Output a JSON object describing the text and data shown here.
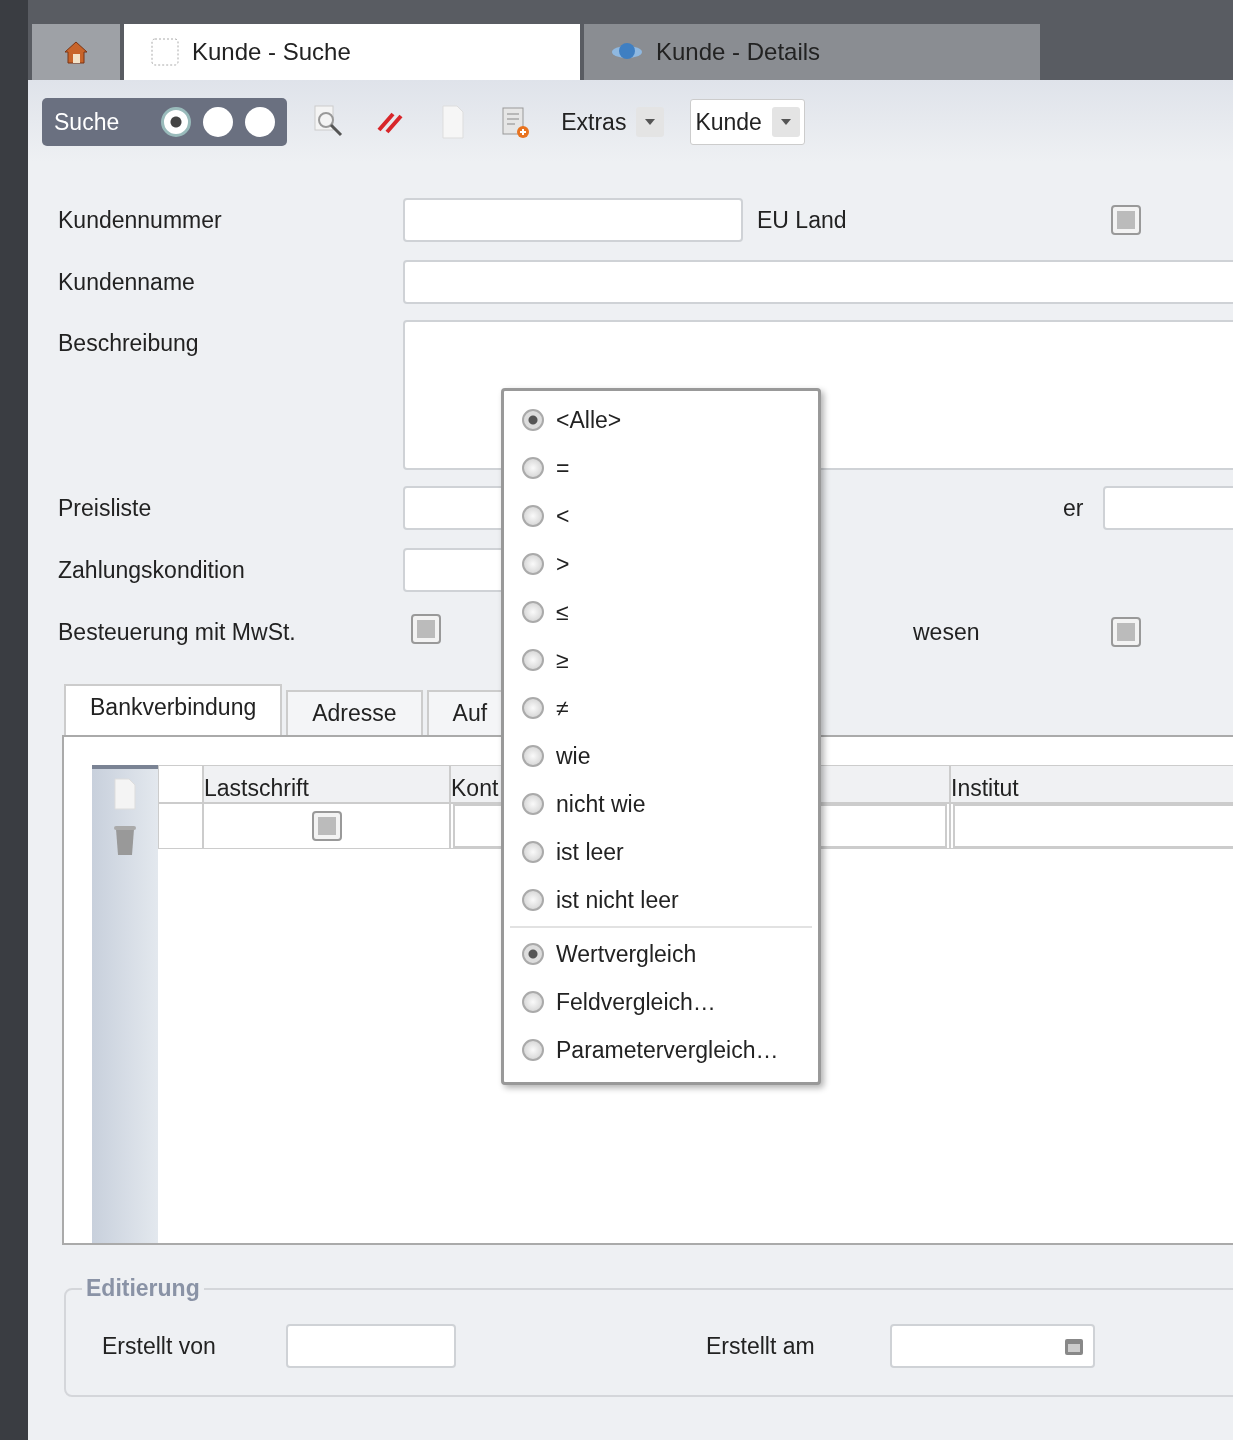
{
  "app_tabs": [
    {
      "kind": "search",
      "label": "Kunde - Suche",
      "selected": true
    },
    {
      "kind": "details",
      "label": "Kunde - Details",
      "selected": false
    }
  ],
  "toolbar": {
    "mode_label": "Suche",
    "mode_options": [
      {
        "selected": true
      },
      {
        "selected": false
      },
      {
        "selected": false
      }
    ],
    "extras": "Extras",
    "entity_select": "Kunde"
  },
  "rows": [
    {
      "kind": "text_with_check",
      "label": "Kundennummer",
      "check_label": "EU Land",
      "indeterminate": true
    },
    {
      "kind": "text",
      "label": "Kundenname"
    },
    {
      "kind": "area",
      "label": "Beschreibung"
    },
    {
      "kind": "text_pair",
      "label": "Preisliste",
      "second_label": "er"
    },
    {
      "kind": "short_text",
      "label": "Zahlungskondition"
    },
    {
      "kind": "check_pair",
      "label": "Besteuerung mit MwSt.",
      "indeterminate": true,
      "second_label": "wesen",
      "second_indeterminate": true
    }
  ],
  "detail_tabs": [
    {
      "label": "Bankverbindung",
      "selected": true
    },
    {
      "label": "Adresse",
      "selected": false
    },
    {
      "label": "Auf",
      "selected": false
    }
  ],
  "table": {
    "columns": [
      {
        "kind": "text",
        "label": "Lastschrift"
      },
      {
        "kind": "text",
        "label": "Kont"
      },
      {
        "kind": "covered"
      },
      {
        "kind": "text",
        "label": "Institut"
      }
    ],
    "row_check_indeterminate": true
  },
  "menu": {
    "operators": [
      {
        "label": "<Alle>",
        "selected": true
      },
      {
        "label": "=",
        "selected": false
      },
      {
        "label": "<",
        "selected": false
      },
      {
        "label": ">",
        "selected": false
      },
      {
        "label": "≤",
        "selected": false
      },
      {
        "label": "≥",
        "selected": false
      },
      {
        "label": "≠",
        "selected": false
      },
      {
        "label": "wie",
        "selected": false
      },
      {
        "label": "nicht wie",
        "selected": false
      },
      {
        "label": "ist leer",
        "selected": false
      },
      {
        "label": "ist nicht leer",
        "selected": false
      }
    ],
    "modes": [
      {
        "label": "Wertvergleich",
        "selected": true
      },
      {
        "label": "Feldvergleich…",
        "selected": false
      },
      {
        "label": "Parametervergleich…",
        "selected": false
      }
    ]
  },
  "editing": {
    "title": "Editierung",
    "fields": [
      {
        "kind": "text",
        "label": "Erstellt von"
      },
      {
        "kind": "date",
        "label": "Erstellt am"
      }
    ]
  }
}
